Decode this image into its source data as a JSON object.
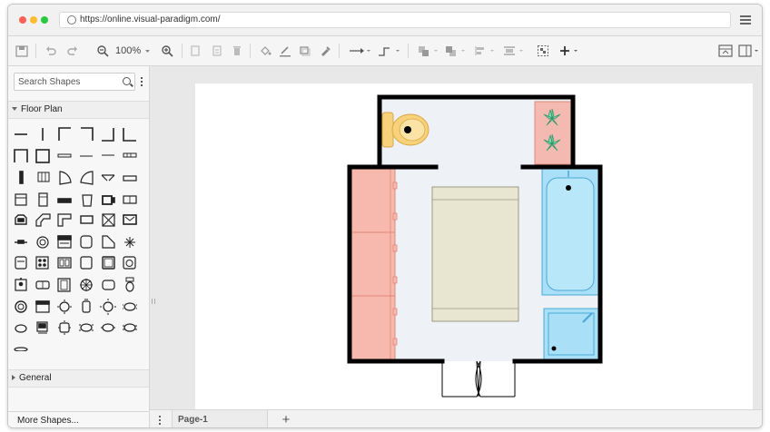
{
  "browser": {
    "url": "https://online.visual-paradigm.com/",
    "dots": [
      "#fe5f57",
      "#febc2e",
      "#28c840"
    ]
  },
  "toolbar": {
    "zoom": "100%",
    "icons": [
      "save-icon",
      "undo-icon",
      "redo-icon",
      "zoom-out-icon",
      "zoom-in-icon",
      "copy-icon",
      "paste-icon",
      "delete-icon",
      "fill-color-icon",
      "line-color-icon",
      "shadow-icon",
      "format-painter-icon",
      "connector-icon",
      "waypoint-icon",
      "to-front-icon",
      "to-back-icon",
      "align-icon",
      "distribute-icon",
      "group-icon",
      "insert-icon",
      "panel-toggle-icon",
      "layout-icon"
    ]
  },
  "sidebar": {
    "search_placeholder": "Search Shapes",
    "sections": [
      {
        "label": "Floor Plan",
        "expanded": true
      },
      {
        "label": "General",
        "expanded": false
      }
    ],
    "more_shapes": "More Shapes..."
  },
  "pages": {
    "tabs": [
      {
        "label": "Page-1"
      }
    ]
  },
  "colors": {
    "wall": "#000000",
    "floor": "#eef1f6",
    "sofa": "#f7b9ad",
    "sofa_stroke": "#e0867a",
    "bathtub": "#a9dff7",
    "bathtub_stroke": "#4aa8d6",
    "rug": "#e8e5d0",
    "rug_stroke": "#9c9a80",
    "toilet": "#f8d27a",
    "plant_box": "#f4b9b0",
    "plant": "#8ee0b9"
  }
}
